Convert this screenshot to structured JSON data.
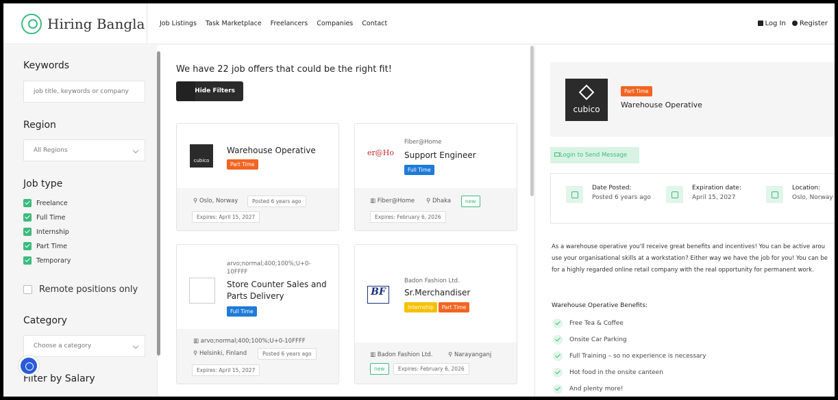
{
  "header": {
    "brand": "Hiring Bangla",
    "nav": [
      "Job Listings",
      "Task Marketplace",
      "Freelancers",
      "Companies",
      "Contact"
    ],
    "login": "Log In",
    "register": "Register"
  },
  "sidebar": {
    "keywords_label": "Keywords",
    "keywords_placeholder": "job title, keywords or company",
    "region_label": "Region",
    "region_value": "All Regions",
    "job_type_label": "Job type",
    "job_types": [
      "Freelance",
      "Full Time",
      "Internship",
      "Part Time",
      "Temporary"
    ],
    "remote_label": "Remote positions only",
    "category_label": "Category",
    "category_value": "Choose a category",
    "salary_label": "Filter by Salary"
  },
  "listing": {
    "results_title": "We have 22 job offers that could be the right fit!",
    "hide_filters": "Hide Filters",
    "cards": [
      {
        "company": "",
        "logo_text": "cubico",
        "title": "Warehouse Operative",
        "badges": [
          "Part Time"
        ],
        "location": "Oslo, Norway",
        "posted": "Posted 6 years ago",
        "expires": "Expires: April 15, 2027"
      },
      {
        "company": "Fiber@Home",
        "logo_text": "er@Ho",
        "title": "Support Engineer",
        "badges": [
          "Full Time"
        ],
        "company_meta": "Fiber@Home",
        "location": "Dhaka",
        "new": "new",
        "expires": "Expires: February 6, 2026"
      },
      {
        "company": "arvo;normal;400;100%;U+0-10FFFF",
        "title": "Store Counter Sales and Parts Delivery",
        "badges": [
          "Full Time"
        ],
        "company_meta": "arvo;normal;400;100%;U+0-10FFFF",
        "location": "Helsinki, Finland",
        "posted": "Posted 6 years ago",
        "expires": "Expires: April 15, 2027"
      },
      {
        "company": "Badon Fashion Ltd.",
        "title": "Sr.Merchandiser",
        "badges": [
          "Internship",
          "Part Time"
        ],
        "company_meta": "Badon Fashion Ltd.",
        "location": "Narayanganj",
        "new": "new",
        "expires": "Expires: February 6, 2026"
      }
    ]
  },
  "detail": {
    "logo_text": "cubico",
    "badge": "Part Time",
    "title": "Warehouse Operative",
    "login_message": "Login to Send Message",
    "date_posted_label": "Date Posted:",
    "date_posted_value": "Posted 6 years ago",
    "expiration_label": "Expiration date:",
    "expiration_value": "April 15, 2027",
    "location_label": "Location:",
    "location_value": "Oslo, Norway",
    "description": [
      "As a warehouse operative you'll receive great benefits and incentives! You can be active arou",
      "use your organisational skills at a workstation? Either way we have the job for you! You can be",
      "for a highly regarded online retail company with the real opportunity for permanent work."
    ],
    "benefits_title": "Warehouse Operative Benefits:",
    "benefits": [
      "Free Tea & Coffee",
      "Onsite Car Parking",
      "Full Training – so no experience is necessary",
      "Hot food in the onsite canteen",
      "And plenty more!"
    ]
  },
  "colors": {
    "accent_green": "#3dba7d",
    "part_time": "#f26522",
    "full_time": "#1f7bd8",
    "internship": "#f5c000"
  }
}
